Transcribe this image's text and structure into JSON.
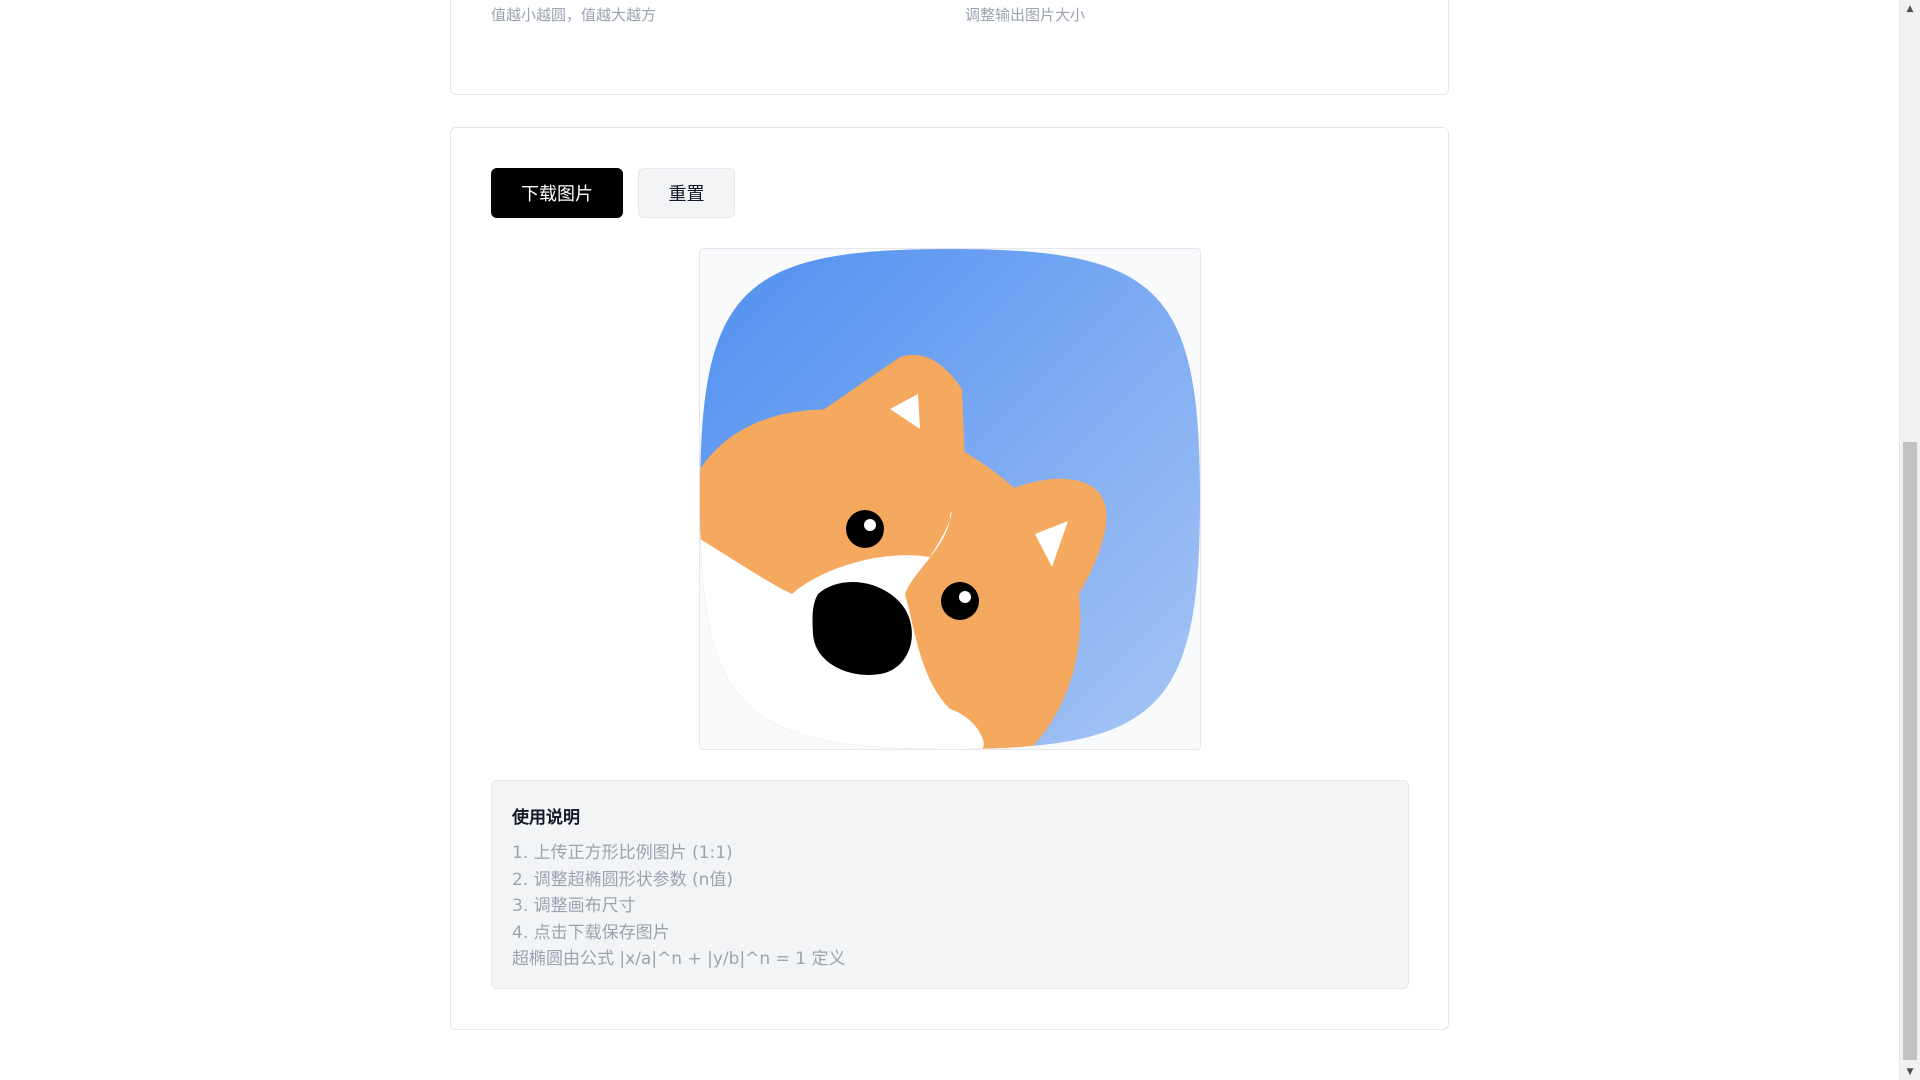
{
  "settings_hints": {
    "n_value_hint": "值越小越圆，值越大越方",
    "size_hint": "调整输出图片大小"
  },
  "actions": {
    "download_label": "下载图片",
    "reset_label": "重置"
  },
  "preview": {
    "image_subject": "corgi-dog-illustration",
    "background_colors": [
      "#4f8ff0",
      "#a9c6f5"
    ],
    "fur_color": "#f4a95e"
  },
  "instructions": {
    "title": "使用说明",
    "steps": [
      "1. 上传正方形比例图片 (1:1)",
      "2. 调整超椭圆形状参数 (n值)",
      "3. 调整画布尺寸",
      "4. 点击下载保存图片"
    ],
    "formula_note": "超椭圆由公式 |x/a|^n + |y/b|^n = 1 定义"
  },
  "colors": {
    "primary_button": "#000000",
    "secondary_button": "#f3f4f6",
    "muted_text": "#9ca3af",
    "border": "#e5e7eb"
  }
}
